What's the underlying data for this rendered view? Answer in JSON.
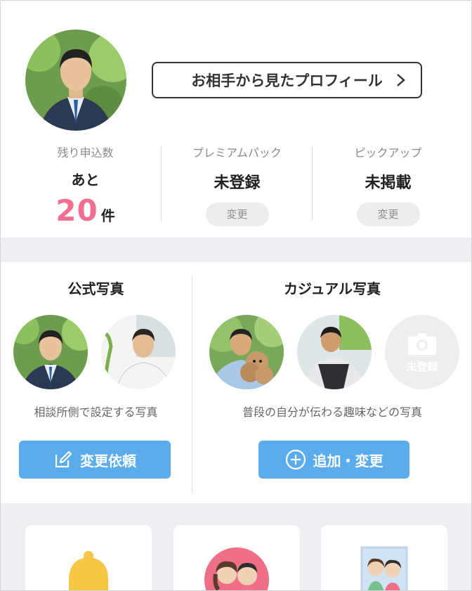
{
  "profile": {
    "view_button_label": "お相手から見たプロフィール"
  },
  "stats": {
    "remaining": {
      "label": "残り申込数",
      "prefix": "あと",
      "count": "20",
      "unit": "件"
    },
    "premium": {
      "label": "プレミアムパック",
      "value": "未登録",
      "button": "変更"
    },
    "pickup": {
      "label": "ピックアップ",
      "value": "未掲載",
      "button": "変更"
    }
  },
  "official_photos": {
    "title": "公式写真",
    "caption": "相談所側で設定する写真",
    "button": "変更依頼"
  },
  "casual_photos": {
    "title": "カジュアル写真",
    "caption": "普段の自分が伝わる趣味などの写真",
    "button": "追加・変更",
    "empty_slot_label": "未登録"
  },
  "colors": {
    "accent_blue": "#5aacec",
    "count_pink": "#f2708f"
  },
  "icons": [
    "chevron-right-icon",
    "edit-icon",
    "plus-circle-icon",
    "camera-icon",
    "bell-icon",
    "couple-icon",
    "photo-frame-icon"
  ]
}
